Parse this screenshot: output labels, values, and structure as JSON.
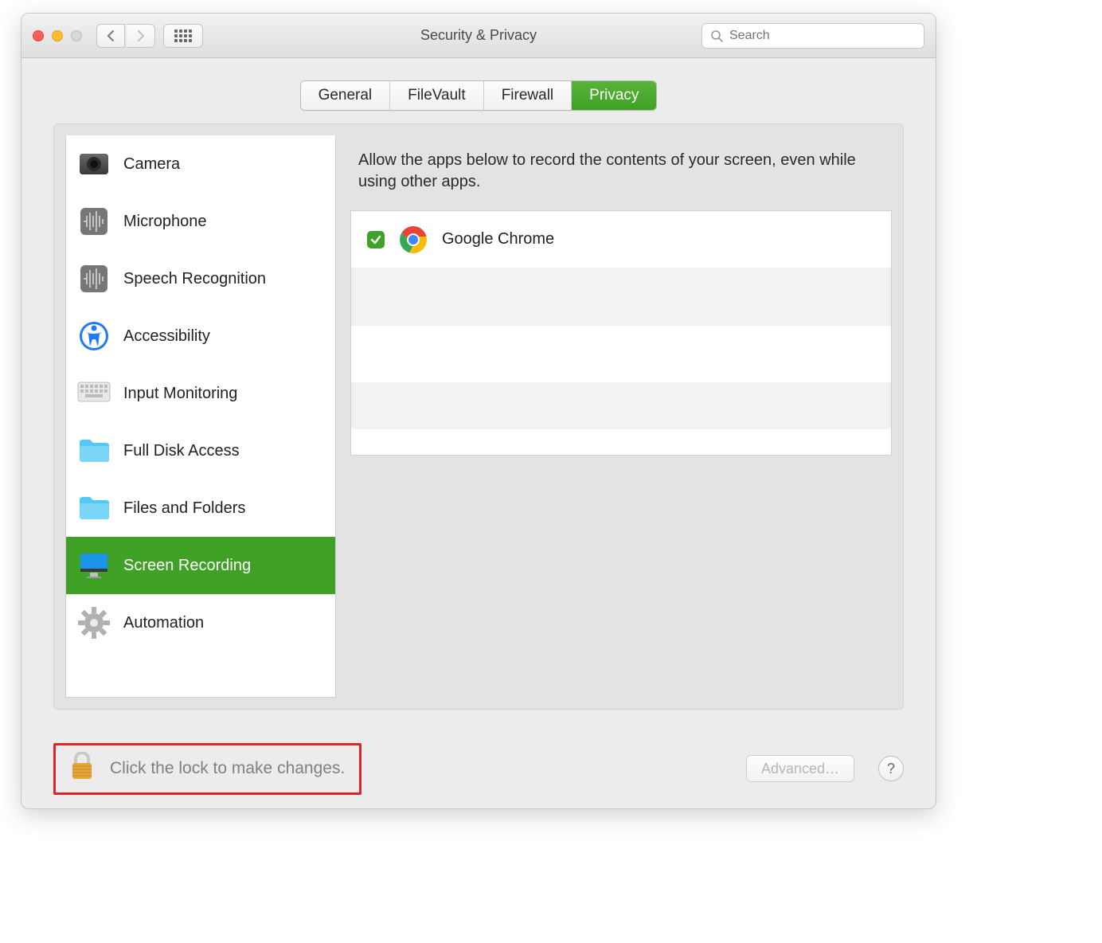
{
  "window": {
    "title": "Security & Privacy"
  },
  "search": {
    "placeholder": "Search"
  },
  "tabs": [
    {
      "label": "General",
      "active": false
    },
    {
      "label": "FileVault",
      "active": false
    },
    {
      "label": "Firewall",
      "active": false
    },
    {
      "label": "Privacy",
      "active": true
    }
  ],
  "sidebar": {
    "items": [
      {
        "label": "Camera",
        "icon": "camera",
        "selected": false
      },
      {
        "label": "Microphone",
        "icon": "microphone",
        "selected": false
      },
      {
        "label": "Speech Recognition",
        "icon": "speech",
        "selected": false
      },
      {
        "label": "Accessibility",
        "icon": "accessibility",
        "selected": false
      },
      {
        "label": "Input Monitoring",
        "icon": "keyboard",
        "selected": false
      },
      {
        "label": "Full Disk Access",
        "icon": "folder",
        "selected": false
      },
      {
        "label": "Files and Folders",
        "icon": "folder",
        "selected": false
      },
      {
        "label": "Screen Recording",
        "icon": "display",
        "selected": true
      },
      {
        "label": "Automation",
        "icon": "gear",
        "selected": false
      }
    ]
  },
  "content": {
    "description": "Allow the apps below to record the contents of your screen, even while using other apps.",
    "apps": [
      {
        "name": "Google Chrome",
        "checked": true,
        "icon": "chrome"
      }
    ]
  },
  "footer": {
    "lock_text": "Click the lock to make changes.",
    "advanced_label": "Advanced…",
    "help_label": "?"
  }
}
